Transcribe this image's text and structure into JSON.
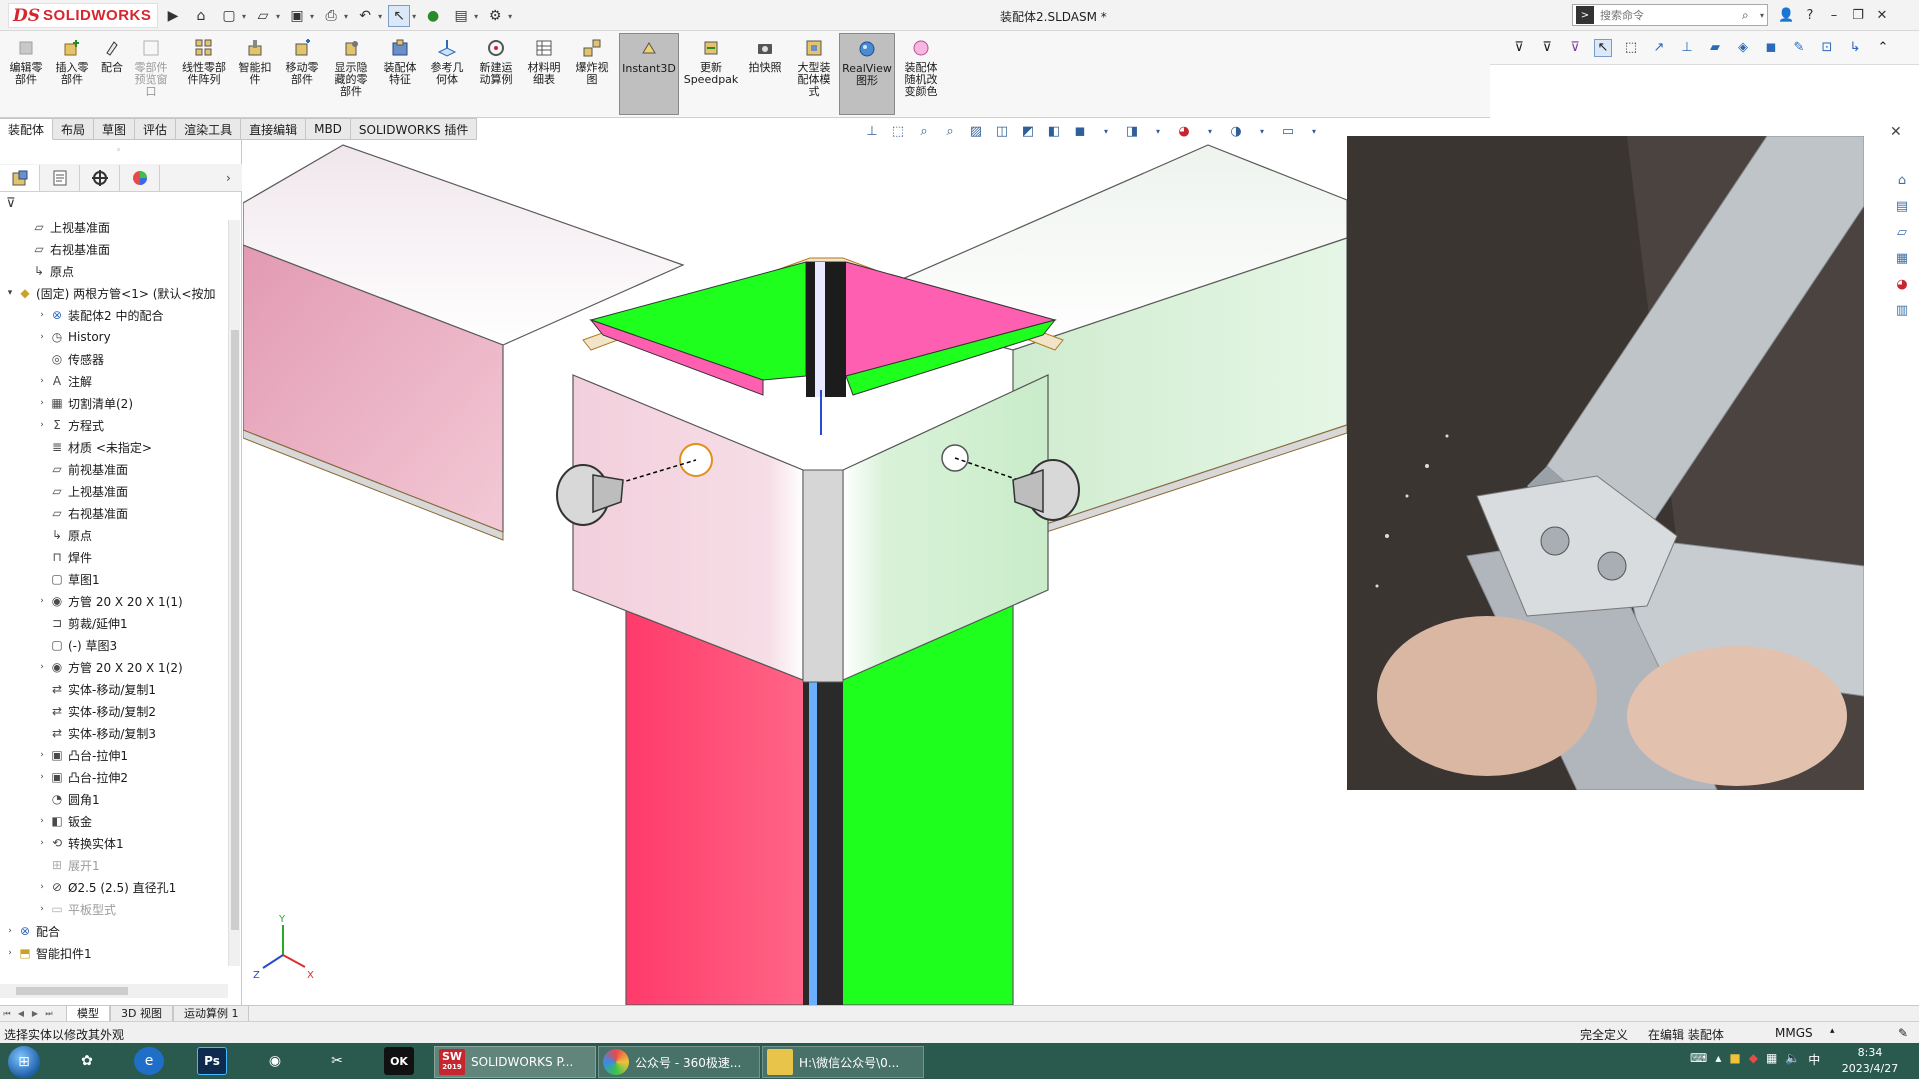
{
  "app": {
    "logo_ds": "DS",
    "logo_text": "SOLIDWORKS",
    "document_title": "装配体2.SLDASM *",
    "search_placeholder": "搜索命令"
  },
  "ribbon": {
    "buttons": [
      {
        "label": "编辑零\n部件",
        "icon": "edit-part-icon",
        "state": "disabled"
      },
      {
        "label": "插入零\n部件",
        "icon": "insert-component-icon",
        "state": "normal"
      },
      {
        "label": "配合",
        "icon": "mate-icon",
        "state": "normal"
      },
      {
        "label": "零部件\n预览窗\n口",
        "icon": "component-preview-icon",
        "state": "disabled"
      },
      {
        "label": "线性零部\n件阵列",
        "icon": "linear-pattern-icon",
        "state": "normal"
      },
      {
        "label": "智能扣\n件",
        "icon": "smart-fastener-icon",
        "state": "normal"
      },
      {
        "label": "移动零\n部件",
        "icon": "move-component-icon",
        "state": "normal"
      },
      {
        "label": "显示隐\n藏的零\n部件",
        "icon": "show-hidden-icon",
        "state": "normal"
      },
      {
        "label": "装配体\n特征",
        "icon": "assembly-feature-icon",
        "state": "normal"
      },
      {
        "label": "参考几\n何体",
        "icon": "reference-geometry-icon",
        "state": "normal"
      },
      {
        "label": "新建运\n动算例",
        "icon": "new-motion-study-icon",
        "state": "normal"
      },
      {
        "label": "材料明\n细表",
        "icon": "bom-icon",
        "state": "normal"
      },
      {
        "label": "爆炸视\n图",
        "icon": "exploded-view-icon",
        "state": "normal"
      },
      {
        "label": "Instant3D",
        "icon": "instant3d-icon",
        "state": "active"
      },
      {
        "label": "更新\nSpeedpak",
        "icon": "speedpak-icon",
        "state": "normal"
      },
      {
        "label": "拍快照",
        "icon": "snapshot-icon",
        "state": "normal"
      },
      {
        "label": "大型装\n配体模\n式",
        "icon": "large-assembly-icon",
        "state": "normal"
      },
      {
        "label": "RealView\n图形",
        "icon": "realview-icon",
        "state": "active"
      },
      {
        "label": "装配体\n随机改\n变颜色",
        "icon": "random-color-icon",
        "state": "normal"
      }
    ]
  },
  "tabs": [
    "装配体",
    "布局",
    "草图",
    "评估",
    "渲染工具",
    "直接编辑",
    "MBD",
    "SOLIDWORKS 插件"
  ],
  "tree": [
    {
      "text": "上视基准面",
      "indent": 0,
      "expander": "",
      "icon": "plane-icon",
      "dim": false
    },
    {
      "text": "右视基准面",
      "indent": 0,
      "expander": "",
      "icon": "plane-icon",
      "dim": false
    },
    {
      "text": "原点",
      "indent": 0,
      "expander": "",
      "icon": "origin-icon",
      "dim": false
    },
    {
      "text": "(固定) 两根方管<1> (默认<按加",
      "indent": -1,
      "expander": "▾",
      "icon": "part-icon",
      "dim": false
    },
    {
      "text": "装配体2 中的配合",
      "indent": 1,
      "expander": "›",
      "icon": "mates-icon",
      "dim": false
    },
    {
      "text": "History",
      "indent": 1,
      "expander": "›",
      "icon": "history-icon",
      "dim": false
    },
    {
      "text": "传感器",
      "indent": 1,
      "expander": "",
      "icon": "sensor-icon",
      "dim": false
    },
    {
      "text": "注解",
      "indent": 1,
      "expander": "›",
      "icon": "annotation-icon",
      "dim": false
    },
    {
      "text": "切割清单(2)",
      "indent": 1,
      "expander": "›",
      "icon": "cutlist-icon",
      "dim": false
    },
    {
      "text": "方程式",
      "indent": 1,
      "expander": "›",
      "icon": "equation-icon",
      "dim": false
    },
    {
      "text": "材质 <未指定>",
      "indent": 1,
      "expander": "",
      "icon": "material-icon",
      "dim": false
    },
    {
      "text": "前视基准面",
      "indent": 1,
      "expander": "",
      "icon": "plane-icon",
      "dim": false
    },
    {
      "text": "上视基准面",
      "indent": 1,
      "expander": "",
      "icon": "plane-icon",
      "dim": false
    },
    {
      "text": "右视基准面",
      "indent": 1,
      "expander": "",
      "icon": "plane-icon",
      "dim": false
    },
    {
      "text": "原点",
      "indent": 1,
      "expander": "",
      "icon": "origin-icon",
      "dim": false
    },
    {
      "text": "焊件",
      "indent": 1,
      "expander": "",
      "icon": "weldment-icon",
      "dim": false
    },
    {
      "text": "草图1",
      "indent": 1,
      "expander": "",
      "icon": "sketch-icon",
      "dim": false
    },
    {
      "text": "方管 20 X 20 X 1(1)",
      "indent": 1,
      "expander": "›",
      "icon": "structural-member-icon",
      "dim": false
    },
    {
      "text": "剪裁/延伸1",
      "indent": 1,
      "expander": "",
      "icon": "trim-icon",
      "dim": false
    },
    {
      "text": "(-) 草图3",
      "indent": 1,
      "expander": "",
      "icon": "sketch-icon",
      "dim": false
    },
    {
      "text": "方管 20 X 20 X 1(2)",
      "indent": 1,
      "expander": "›",
      "icon": "structural-member-icon",
      "dim": false
    },
    {
      "text": "实体-移动/复制1",
      "indent": 1,
      "expander": "",
      "icon": "move-body-icon",
      "dim": false
    },
    {
      "text": "实体-移动/复制2",
      "indent": 1,
      "expander": "",
      "icon": "move-body-icon",
      "dim": false
    },
    {
      "text": "实体-移动/复制3",
      "indent": 1,
      "expander": "",
      "icon": "move-body-icon",
      "dim": false
    },
    {
      "text": "凸台-拉伸1",
      "indent": 1,
      "expander": "›",
      "icon": "extrude-icon",
      "dim": false
    },
    {
      "text": "凸台-拉伸2",
      "indent": 1,
      "expander": "›",
      "icon": "extrude-icon",
      "dim": false
    },
    {
      "text": "圆角1",
      "indent": 1,
      "expander": "",
      "icon": "fillet-icon",
      "dim": false
    },
    {
      "text": "钣金",
      "indent": 1,
      "expander": "›",
      "icon": "sheetmetal-icon",
      "dim": false
    },
    {
      "text": "转换实体1",
      "indent": 1,
      "expander": "›",
      "icon": "convert-body-icon",
      "dim": false
    },
    {
      "text": "展开1",
      "indent": 1,
      "expander": "",
      "icon": "unfold-icon",
      "dim": true
    },
    {
      "text": "Ø2.5 (2.5) 直径孔1",
      "indent": 1,
      "expander": "›",
      "icon": "hole-icon",
      "dim": false
    },
    {
      "text": "平板型式",
      "indent": 1,
      "expander": "›",
      "icon": "flat-pattern-icon",
      "dim": true
    },
    {
      "text": "配合",
      "indent": -1,
      "expander": "›",
      "icon": "mates-icon",
      "dim": false
    },
    {
      "text": "智能扣件1",
      "indent": -1,
      "expander": "›",
      "icon": "smart-fastener-icon",
      "dim": false
    }
  ],
  "triad": {
    "y": "Y",
    "z": "Z",
    "x": "X"
  },
  "bottom_tabs": [
    "模型",
    "3D 视图",
    "运动算例 1"
  ],
  "status": {
    "message": "选择实体以修改其外观",
    "definition": "完全定义",
    "editing": "在编辑 装配体",
    "units": "MMGS"
  },
  "taskbar": {
    "apps": [
      {
        "label": "SOLIDWORKS P...",
        "badge": "SW",
        "sub": "2019",
        "color": "#c8262e",
        "active": true
      },
      {
        "label": "公众号 - 360极速...",
        "badge": "",
        "sub": "",
        "color": "#e8a33a",
        "active": false
      },
      {
        "label": "H:\\微信公众号\\0...",
        "badge": "",
        "sub": "",
        "color": "#e8c54a",
        "active": false
      }
    ],
    "time": "8:34",
    "date": "2023/4/27"
  }
}
